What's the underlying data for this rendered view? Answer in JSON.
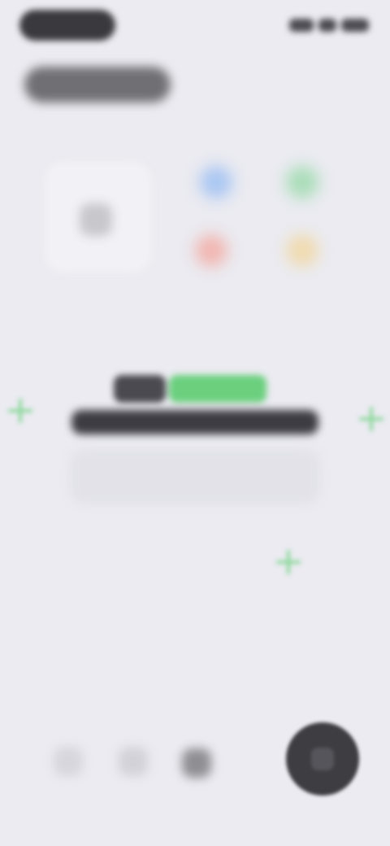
{
  "status_bar": {
    "time": "",
    "icons": [
      "signal-icon",
      "wifi-icon",
      "battery-icon"
    ]
  },
  "header": {
    "title": ""
  },
  "apps": {
    "featured_label": "",
    "grid_label": "",
    "dots": [
      "blue",
      "green",
      "red",
      "yellow"
    ]
  },
  "banner": {
    "line1_dark": "",
    "line1_green": "",
    "line2": "",
    "body": ""
  },
  "tab_bar": {
    "tabs": [
      {
        "icon": "tab-one-icon"
      },
      {
        "icon": "tab-two-icon"
      },
      {
        "icon": "tab-three-icon"
      }
    ],
    "action_icon": "action-icon"
  },
  "colors": {
    "background": "#ebebf1",
    "accent": "#6bcf7e",
    "dark": "#3d3d42",
    "blue": "#a9c6f2",
    "green": "#a9ddb8",
    "red": "#f1b6b1",
    "yellow": "#f0dbb0"
  }
}
